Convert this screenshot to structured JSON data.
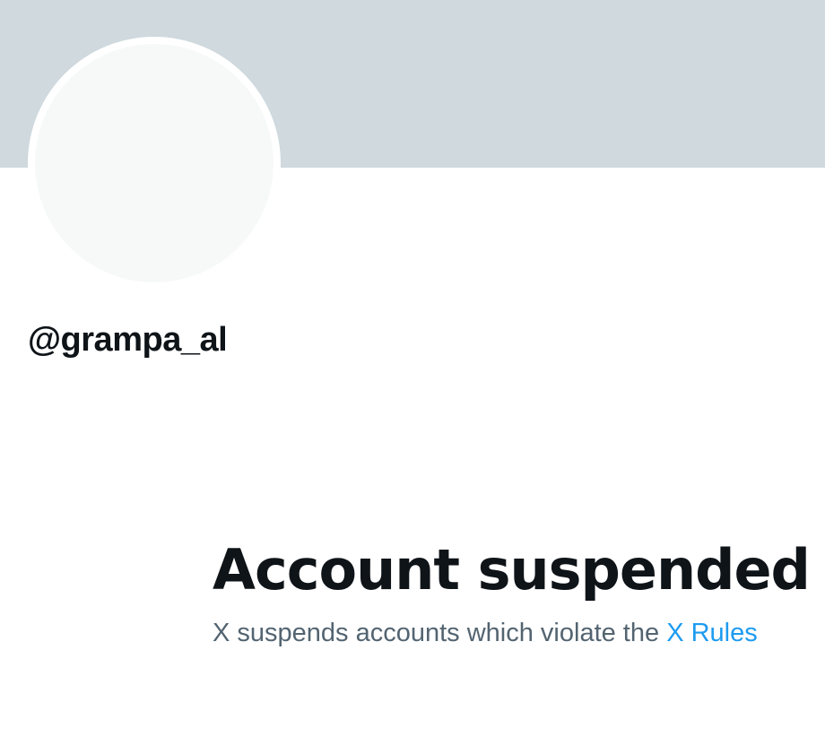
{
  "profile": {
    "handle": "@grampa_al"
  },
  "suspension": {
    "title": "Account suspended",
    "description_prefix": "X suspends accounts which violate the",
    "rules_link_label": "X Rules"
  },
  "colors": {
    "banner": "#cfd9de",
    "avatar_placeholder": "#f7f9f9",
    "primary_text": "#0f1419",
    "secondary_text": "#536471",
    "link": "#1d9bf0"
  }
}
